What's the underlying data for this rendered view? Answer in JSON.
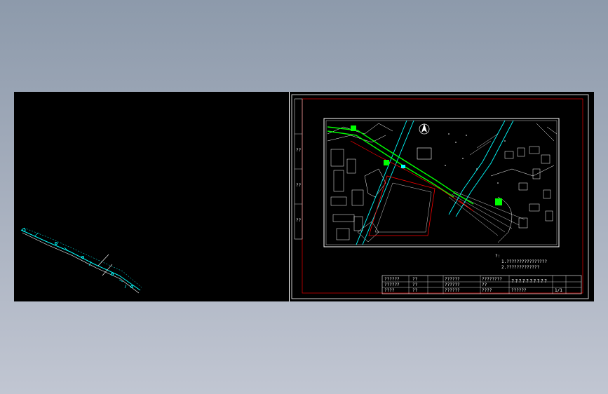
{
  "drawing": {
    "project_title": "??????????",
    "drawing_name": "??????",
    "sheet_label": "1/1",
    "north_arrow_icon": "north-arrow-icon",
    "colors": {
      "background": "#000000",
      "frame": "#ffffff",
      "border_red": "#cc0000",
      "pipeline_green": "#00ff00",
      "cyan": "#00ffff",
      "red": "#ff0000"
    }
  },
  "title_block": {
    "left_labels": [
      "??????",
      "??????",
      "????"
    ],
    "mid_labels": [
      "??",
      "??",
      "??"
    ],
    "right_labels": [
      "??????",
      "??????",
      "??????"
    ],
    "right_values": [
      "????????",
      "??",
      "????"
    ]
  },
  "notes": [
    "?:",
    "1.????????????????",
    "2.?????????????"
  ]
}
